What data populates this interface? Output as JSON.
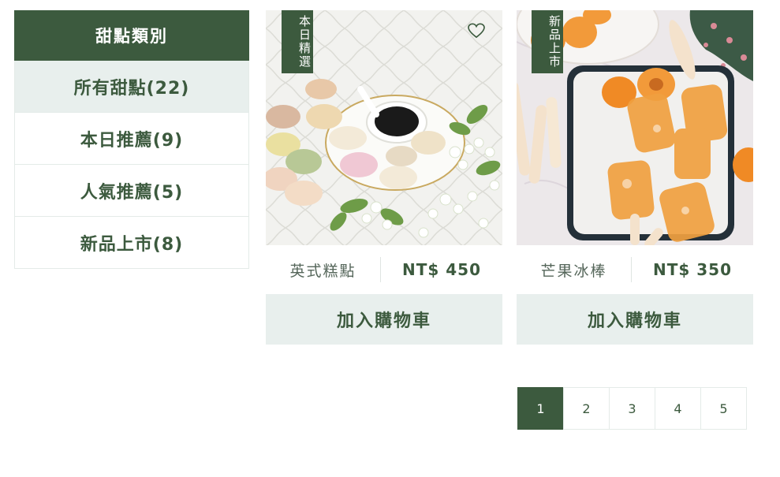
{
  "sidebar": {
    "title": "甜點類別",
    "items": [
      {
        "label": "所有甜點(22)"
      },
      {
        "label": "本日推薦(9)"
      },
      {
        "label": "人氣推薦(5)"
      },
      {
        "label": "新品上市(8)"
      }
    ]
  },
  "products": [
    {
      "badge": "本日精選",
      "name": "英式糕點",
      "price": "NT$ 450",
      "button": "加入購物車",
      "icon": "heart-icon"
    },
    {
      "badge": "新品上市",
      "name": "芒果冰棒",
      "price": "NT$ 350",
      "button": "加入購物車"
    }
  ],
  "pagination": {
    "pages": [
      "1",
      "2",
      "3",
      "4",
      "5"
    ],
    "current": "1"
  },
  "colors": {
    "primary": "#3c5a3e",
    "light": "#e8efed",
    "border": "#e4ebe8"
  }
}
